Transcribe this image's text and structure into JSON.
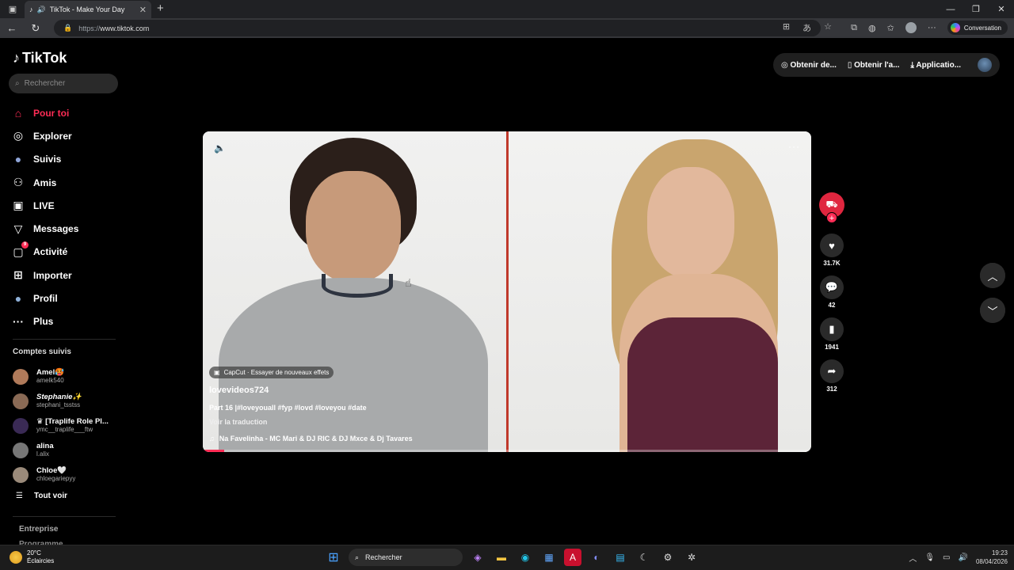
{
  "browser": {
    "tab_title": "TikTok - Make Your Day",
    "url_scheme": "https://",
    "url_host": "www.tiktok.com",
    "conversation_label": "Conversation"
  },
  "sidebar": {
    "logo_text": "TikTok",
    "search_placeholder": "Rechercher",
    "nav": [
      {
        "label": "Pour toi",
        "icon": "home-icon",
        "glyph": "⌂"
      },
      {
        "label": "Explorer",
        "icon": "compass-icon",
        "glyph": "◎"
      },
      {
        "label": "Suivis",
        "icon": "following-avatar-icon",
        "glyph": "●"
      },
      {
        "label": "Amis",
        "icon": "friends-icon",
        "glyph": "👥"
      },
      {
        "label": "LIVE",
        "icon": "live-icon",
        "glyph": "▣"
      },
      {
        "label": "Messages",
        "icon": "messages-icon",
        "glyph": "▽"
      },
      {
        "label": "Activité",
        "icon": "activity-icon",
        "glyph": "▢",
        "badge": "9"
      },
      {
        "label": "Importer",
        "icon": "upload-icon",
        "glyph": "⊞"
      },
      {
        "label": "Profil",
        "icon": "profile-icon",
        "glyph": "●"
      },
      {
        "label": "Plus",
        "icon": "more-icon",
        "glyph": "···"
      }
    ],
    "following_title": "Comptes suivis",
    "following": [
      {
        "name": "Amel🥵",
        "user": "amelk540",
        "color": "#b07a5a"
      },
      {
        "name": "Stephanie✨",
        "user": "stephani_tsstss",
        "color": "#8a6a55"
      },
      {
        "name": "♛ [Traplife Role Pl...",
        "user": "ymc__traplife___ftw",
        "color": "#3a2a55"
      },
      {
        "name": "alina",
        "user": "l.alix",
        "color": "#777"
      },
      {
        "name": "Chloe🤍",
        "user": "chloegariepyy",
        "color": "#9a8a7a"
      }
    ],
    "see_all": "Tout voir",
    "footer_1": "Entreprise",
    "footer_2": "Programme"
  },
  "header": {
    "btn1": "Obtenir de...",
    "btn2": "Obtenir l'a...",
    "btn3": "Applicatio..."
  },
  "video": {
    "effect_label": "CapCut · Essayer de nouveaux effets",
    "author": "lovevideos724",
    "caption": "Part 16 |#loveyouall #fyp #lovd #loveyou #date",
    "translate": "Voir la traduction",
    "music": "Na Favelinha - MC Mari & DJ RIC & DJ Mxce & Dj Tavares",
    "progress": 0.035
  },
  "actions": {
    "likes": "31.7K",
    "comments": "42",
    "saves": "1941",
    "shares": "312"
  },
  "taskbar": {
    "temp": "20°C",
    "weather": "Éclaircies",
    "search": "Rechercher",
    "time": "19:23",
    "date": "08/04/2026"
  }
}
